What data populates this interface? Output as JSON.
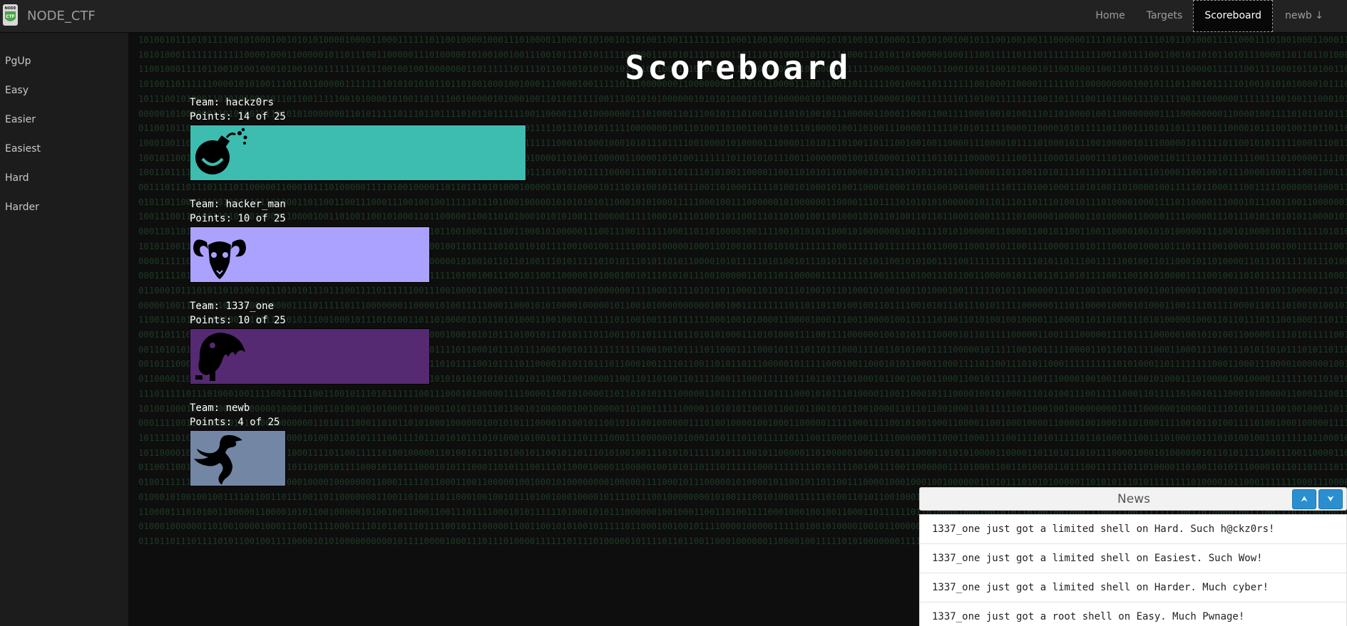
{
  "brand": {
    "name": "NODE_CTF",
    "logo_text": "NODE CTF"
  },
  "nav": {
    "items": [
      {
        "label": "Home",
        "active": false
      },
      {
        "label": "Targets",
        "active": false
      },
      {
        "label": "Scoreboard",
        "active": true
      }
    ],
    "user": "newb ↓"
  },
  "sidebar": {
    "items": [
      "PgUp",
      "Easy",
      "Easier",
      "Easiest",
      "Hard",
      "Harder"
    ]
  },
  "page": {
    "title": "Scoreboard"
  },
  "teams": [
    {
      "team_label": "Team: hackz0rs",
      "points_label": "Points: 14 of 25",
      "points": 14,
      "max": 25,
      "color": "#3dbcb0",
      "icon": "bomb-icon"
    },
    {
      "team_label": "Team: hacker_man",
      "points_label": "Points: 10 of 25",
      "points": 10,
      "max": 25,
      "color": "#aba2ff",
      "icon": "ram-skull-icon"
    },
    {
      "team_label": "Team: 1337_one",
      "points_label": "Points: 10 of 25",
      "points": 10,
      "max": 25,
      "color": "#552a72",
      "icon": "monster-icon"
    },
    {
      "team_label": "Team: newb",
      "points_label": "Points: 4 of 25",
      "points": 4,
      "max": 25,
      "color": "#7387a4",
      "icon": "dragon-icon"
    }
  ],
  "news": {
    "title": "News",
    "up_icon": "arrow-up-icon",
    "down_icon": "arrow-down-icon",
    "items": [
      "1337_one just got a limited shell on Hard. Such h@ckz0rs!",
      "1337_one just got a limited shell on Easiest. Such Wow!",
      "1337_one just got a limited shell on Harder. Much cyber!",
      "1337_one just got a root shell on Easy. Much Pwnage!"
    ]
  },
  "colors": {
    "navbar": "#222222",
    "background": "#0e0e0e",
    "binary_text": "#1e3b25",
    "news_button": "#2a8fd0"
  }
}
